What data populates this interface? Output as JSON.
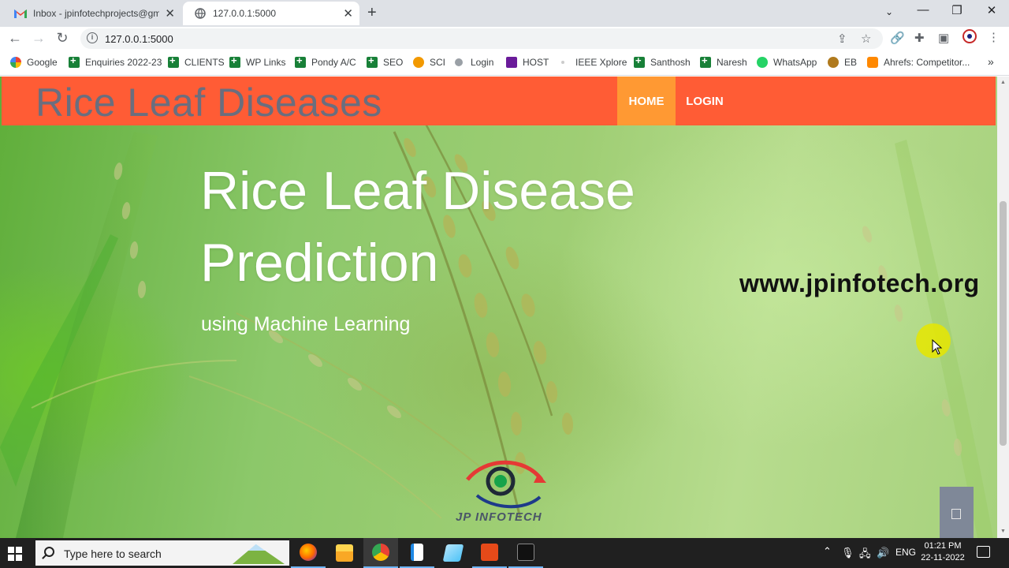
{
  "browser": {
    "tabs": [
      {
        "title": "Inbox - jpinfotechprojects@gmail.com",
        "icon": "gmail-icon",
        "active": false
      },
      {
        "title": "127.0.0.1:5000",
        "icon": "globe-icon",
        "active": true
      }
    ],
    "url": "127.0.0.1:5000",
    "bookmarks": [
      {
        "label": "Google",
        "icon": "google-icon"
      },
      {
        "label": "Enquiries 2022-23",
        "icon": "sheets-icon"
      },
      {
        "label": "CLIENTS",
        "icon": "sheets-icon"
      },
      {
        "label": "WP Links",
        "icon": "sheets-icon"
      },
      {
        "label": "Pondy A/C",
        "icon": "sheets-icon"
      },
      {
        "label": "SEO",
        "icon": "sheets-icon"
      },
      {
        "label": "SCI",
        "icon": "sun-icon"
      },
      {
        "label": "Login",
        "icon": "login-icon"
      },
      {
        "label": "HOST",
        "icon": "host-icon"
      },
      {
        "label": "IEEE Xplore",
        "icon": "ieee-icon"
      },
      {
        "label": "Santhosh",
        "icon": "sheets-icon"
      },
      {
        "label": "Naresh",
        "icon": "sheets-icon"
      },
      {
        "label": "WhatsApp",
        "icon": "whatsapp-icon"
      },
      {
        "label": "EB",
        "icon": "emblem-icon"
      },
      {
        "label": "Ahrefs: Competitor...",
        "icon": "ahrefs-icon"
      }
    ],
    "overflow": "»"
  },
  "page": {
    "brand": "Rice Leaf Diseases",
    "nav": {
      "home": "HOME",
      "login": "LOGIN"
    },
    "hero": {
      "title": "Rice Leaf Disease Prediction",
      "subtitle": "using Machine Learning"
    },
    "watermark_url": "www.jpinfotech.org",
    "logo_text": "JP INFOTECH",
    "colors": {
      "navbar": "#ff5c35",
      "active_nav": "#ff9933",
      "brand_text": "#6b6e7e"
    }
  },
  "taskbar": {
    "search_placeholder": "Type here to search",
    "apps": [
      "firefox-icon",
      "file-explorer-icon",
      "chrome-icon",
      "document-icon",
      "app-icon",
      "cisco-icon",
      "terminal-icon"
    ],
    "language": "ENG",
    "time": "01:21 PM",
    "date": "22-11-2022"
  }
}
